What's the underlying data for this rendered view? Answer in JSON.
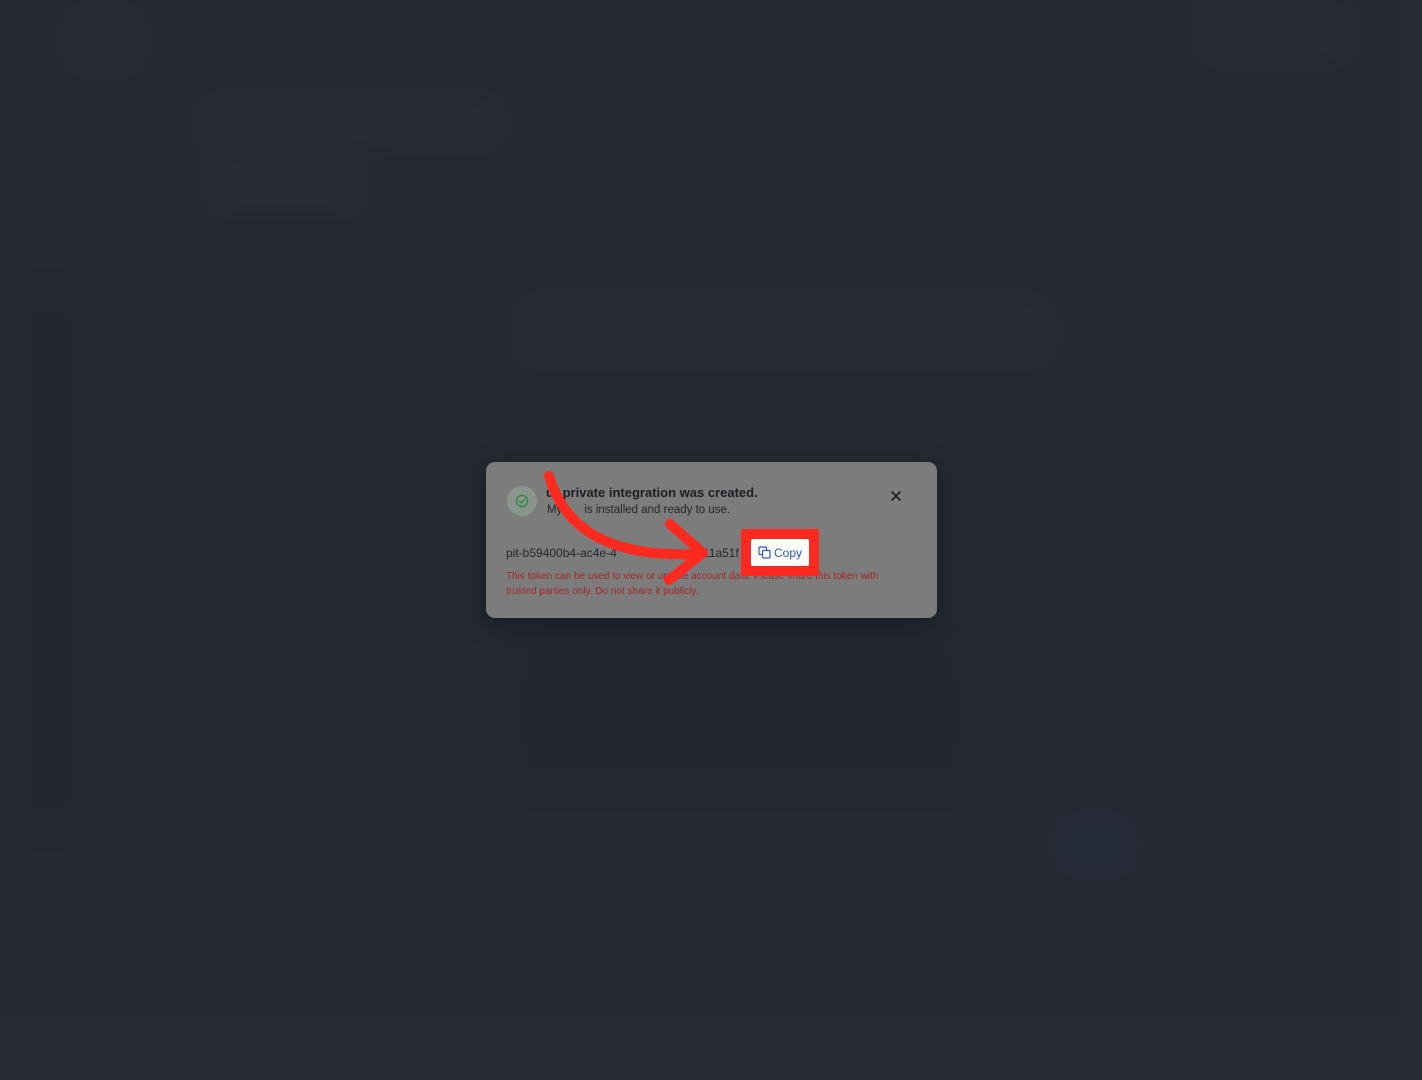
{
  "modal": {
    "title": "Your private integration was created.",
    "title_visible": "ur private integration was created.",
    "subtitle_left": "My",
    "subtitle_right": "is installed and ready to use.",
    "token_start": "pit-b59400b4-ac4e-4",
    "token_end": "11a51f",
    "warning": "This token can be used to view or update account data. Please share this token with trusted parties only. Do not share it publicly.",
    "close_icon": "close-icon",
    "success_icon": "check-circle-icon"
  },
  "copy_button": {
    "label": "Copy",
    "icon": "copy-icon"
  },
  "colors": {
    "annotation": "#ff2a1f",
    "copy_text": "#2d56c9",
    "warning": "#a5262b",
    "success": "#2e8b3e"
  }
}
